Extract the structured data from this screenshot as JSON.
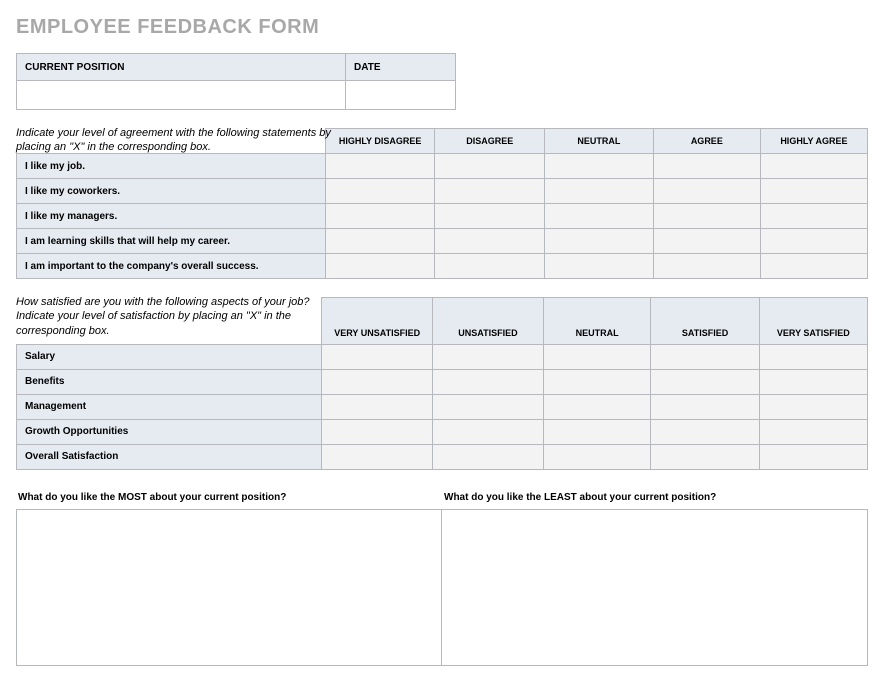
{
  "title": "EMPLOYEE FEEDBACK FORM",
  "header": {
    "position_label": "CURRENT POSITION",
    "date_label": "DATE",
    "position_value": "",
    "date_value": ""
  },
  "section1": {
    "instruction": "Indicate your level of agreement with the following statements by placing an \"X\" in the corresponding box.",
    "columns": [
      "HIGHLY DISAGREE",
      "DISAGREE",
      "NEUTRAL",
      "AGREE",
      "HIGHLY AGREE"
    ],
    "rows": [
      "I like my job.",
      "I like my coworkers.",
      "I like my managers.",
      "I am learning skills that will help my career.",
      "I am important to the company's overall success."
    ]
  },
  "section2": {
    "instruction": "How satisfied are you with the following aspects of your job? Indicate your level of satisfaction by placing an \"X\" in the corresponding box.",
    "columns": [
      "VERY UNSATISFIED",
      "UNSATISFIED",
      "NEUTRAL",
      "SATISFIED",
      "VERY SATISFIED"
    ],
    "rows": [
      "Salary",
      "Benefits",
      "Management",
      "Growth Opportunities",
      "Overall Satisfaction"
    ]
  },
  "free_response": {
    "most_q": "What do you like the MOST about your current position?",
    "least_q": "What do you like the LEAST about your current position?",
    "most_a": "",
    "least_a": ""
  }
}
